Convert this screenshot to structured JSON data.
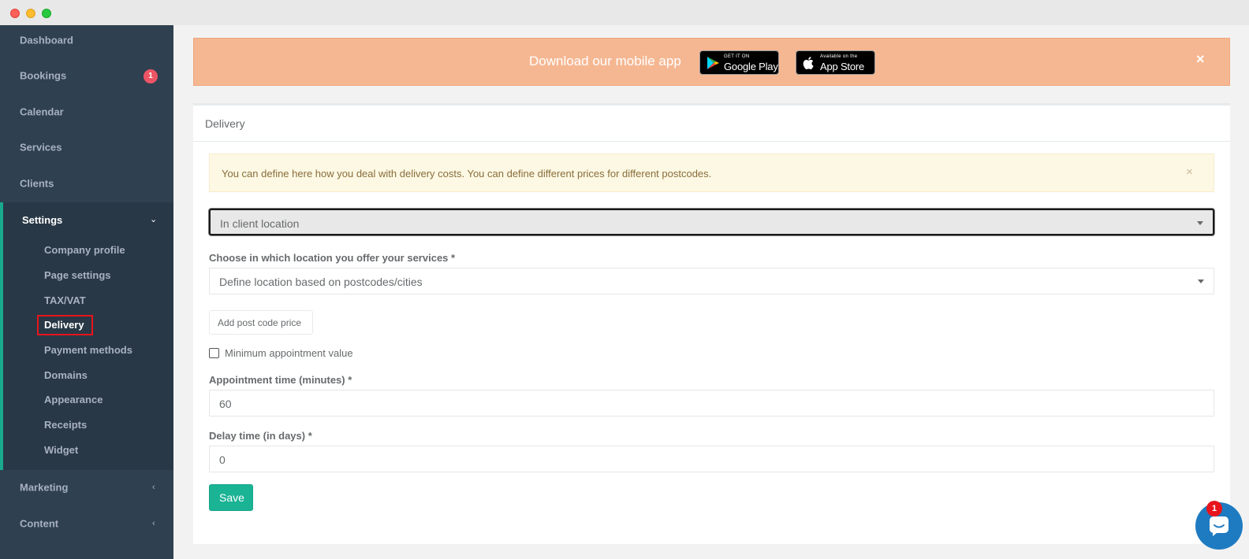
{
  "sidebar": {
    "items": [
      {
        "label": "Dashboard"
      },
      {
        "label": "Bookings",
        "badge": "1"
      },
      {
        "label": "Calendar"
      },
      {
        "label": "Services"
      },
      {
        "label": "Clients"
      }
    ],
    "settings": {
      "label": "Settings",
      "subitems": [
        {
          "label": "Company profile"
        },
        {
          "label": "Page settings"
        },
        {
          "label": "TAX/VAT"
        },
        {
          "label": "Delivery"
        },
        {
          "label": "Payment methods"
        },
        {
          "label": "Domains"
        },
        {
          "label": "Appearance"
        },
        {
          "label": "Receipts"
        },
        {
          "label": "Widget"
        }
      ]
    },
    "bottom_items": [
      {
        "label": "Marketing"
      },
      {
        "label": "Content"
      }
    ]
  },
  "promo": {
    "text": "Download our mobile app",
    "google_play_small": "GET IT ON",
    "google_play_big": "Google Play",
    "app_store_small": "Available on the",
    "app_store_big": "App Store",
    "close": "×"
  },
  "card": {
    "title": "Delivery",
    "alert": "You can define here how you deal with delivery costs. You can define different prices for different postcodes.",
    "alert_close": "×",
    "delivery_type": "In client location",
    "location_label": "Choose in which location you offer your services *",
    "location_value": "Define location based on postcodes/cities",
    "add_postcode_button": "Add post code price",
    "min_value_label": "Minimum appointment value",
    "appointment_time_label": "Appointment time (minutes) *",
    "appointment_time_value": "60",
    "delay_time_label": "Delay time (in days) *",
    "delay_time_value": "0",
    "save_button": "Save"
  },
  "chat": {
    "badge": "1"
  },
  "colors": {
    "sidebar_bg": "#2f4050",
    "accent": "#1ab394",
    "promo_bg": "#f5b792",
    "badge": "#ed5565"
  }
}
